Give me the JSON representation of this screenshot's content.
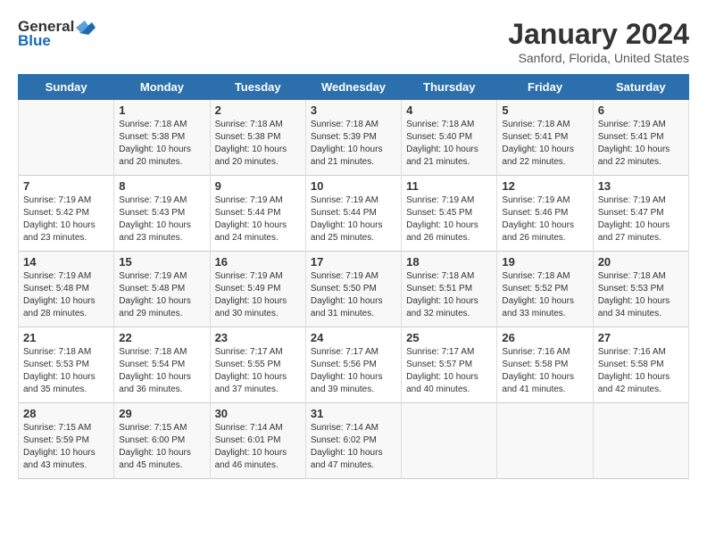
{
  "header": {
    "logo_general": "General",
    "logo_blue": "Blue",
    "title": "January 2024",
    "location": "Sanford, Florida, United States"
  },
  "days_of_week": [
    "Sunday",
    "Monday",
    "Tuesday",
    "Wednesday",
    "Thursday",
    "Friday",
    "Saturday"
  ],
  "weeks": [
    [
      {
        "day": "",
        "content": ""
      },
      {
        "day": "1",
        "content": "Sunrise: 7:18 AM\nSunset: 5:38 PM\nDaylight: 10 hours\nand 20 minutes."
      },
      {
        "day": "2",
        "content": "Sunrise: 7:18 AM\nSunset: 5:38 PM\nDaylight: 10 hours\nand 20 minutes."
      },
      {
        "day": "3",
        "content": "Sunrise: 7:18 AM\nSunset: 5:39 PM\nDaylight: 10 hours\nand 21 minutes."
      },
      {
        "day": "4",
        "content": "Sunrise: 7:18 AM\nSunset: 5:40 PM\nDaylight: 10 hours\nand 21 minutes."
      },
      {
        "day": "5",
        "content": "Sunrise: 7:18 AM\nSunset: 5:41 PM\nDaylight: 10 hours\nand 22 minutes."
      },
      {
        "day": "6",
        "content": "Sunrise: 7:19 AM\nSunset: 5:41 PM\nDaylight: 10 hours\nand 22 minutes."
      }
    ],
    [
      {
        "day": "7",
        "content": "Sunrise: 7:19 AM\nSunset: 5:42 PM\nDaylight: 10 hours\nand 23 minutes."
      },
      {
        "day": "8",
        "content": "Sunrise: 7:19 AM\nSunset: 5:43 PM\nDaylight: 10 hours\nand 23 minutes."
      },
      {
        "day": "9",
        "content": "Sunrise: 7:19 AM\nSunset: 5:44 PM\nDaylight: 10 hours\nand 24 minutes."
      },
      {
        "day": "10",
        "content": "Sunrise: 7:19 AM\nSunset: 5:44 PM\nDaylight: 10 hours\nand 25 minutes."
      },
      {
        "day": "11",
        "content": "Sunrise: 7:19 AM\nSunset: 5:45 PM\nDaylight: 10 hours\nand 26 minutes."
      },
      {
        "day": "12",
        "content": "Sunrise: 7:19 AM\nSunset: 5:46 PM\nDaylight: 10 hours\nand 26 minutes."
      },
      {
        "day": "13",
        "content": "Sunrise: 7:19 AM\nSunset: 5:47 PM\nDaylight: 10 hours\nand 27 minutes."
      }
    ],
    [
      {
        "day": "14",
        "content": "Sunrise: 7:19 AM\nSunset: 5:48 PM\nDaylight: 10 hours\nand 28 minutes."
      },
      {
        "day": "15",
        "content": "Sunrise: 7:19 AM\nSunset: 5:48 PM\nDaylight: 10 hours\nand 29 minutes."
      },
      {
        "day": "16",
        "content": "Sunrise: 7:19 AM\nSunset: 5:49 PM\nDaylight: 10 hours\nand 30 minutes."
      },
      {
        "day": "17",
        "content": "Sunrise: 7:19 AM\nSunset: 5:50 PM\nDaylight: 10 hours\nand 31 minutes."
      },
      {
        "day": "18",
        "content": "Sunrise: 7:18 AM\nSunset: 5:51 PM\nDaylight: 10 hours\nand 32 minutes."
      },
      {
        "day": "19",
        "content": "Sunrise: 7:18 AM\nSunset: 5:52 PM\nDaylight: 10 hours\nand 33 minutes."
      },
      {
        "day": "20",
        "content": "Sunrise: 7:18 AM\nSunset: 5:53 PM\nDaylight: 10 hours\nand 34 minutes."
      }
    ],
    [
      {
        "day": "21",
        "content": "Sunrise: 7:18 AM\nSunset: 5:53 PM\nDaylight: 10 hours\nand 35 minutes."
      },
      {
        "day": "22",
        "content": "Sunrise: 7:18 AM\nSunset: 5:54 PM\nDaylight: 10 hours\nand 36 minutes."
      },
      {
        "day": "23",
        "content": "Sunrise: 7:17 AM\nSunset: 5:55 PM\nDaylight: 10 hours\nand 37 minutes."
      },
      {
        "day": "24",
        "content": "Sunrise: 7:17 AM\nSunset: 5:56 PM\nDaylight: 10 hours\nand 39 minutes."
      },
      {
        "day": "25",
        "content": "Sunrise: 7:17 AM\nSunset: 5:57 PM\nDaylight: 10 hours\nand 40 minutes."
      },
      {
        "day": "26",
        "content": "Sunrise: 7:16 AM\nSunset: 5:58 PM\nDaylight: 10 hours\nand 41 minutes."
      },
      {
        "day": "27",
        "content": "Sunrise: 7:16 AM\nSunset: 5:58 PM\nDaylight: 10 hours\nand 42 minutes."
      }
    ],
    [
      {
        "day": "28",
        "content": "Sunrise: 7:15 AM\nSunset: 5:59 PM\nDaylight: 10 hours\nand 43 minutes."
      },
      {
        "day": "29",
        "content": "Sunrise: 7:15 AM\nSunset: 6:00 PM\nDaylight: 10 hours\nand 45 minutes."
      },
      {
        "day": "30",
        "content": "Sunrise: 7:14 AM\nSunset: 6:01 PM\nDaylight: 10 hours\nand 46 minutes."
      },
      {
        "day": "31",
        "content": "Sunrise: 7:14 AM\nSunset: 6:02 PM\nDaylight: 10 hours\nand 47 minutes."
      },
      {
        "day": "",
        "content": ""
      },
      {
        "day": "",
        "content": ""
      },
      {
        "day": "",
        "content": ""
      }
    ]
  ]
}
